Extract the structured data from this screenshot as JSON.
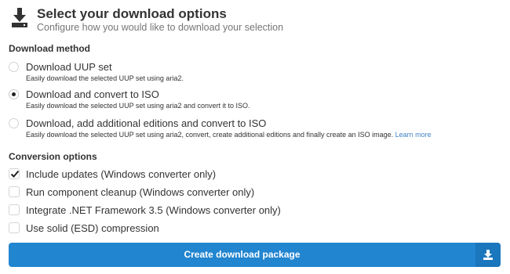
{
  "header": {
    "icon": "download-icon",
    "title": "Select your download options",
    "subtitle": "Configure how you would like to download your selection"
  },
  "download_method": {
    "title": "Download method",
    "options": [
      {
        "label": "Download UUP set",
        "description": "Easily download the selected UUP set using aria2.",
        "selected": false
      },
      {
        "label": "Download and convert to ISO",
        "description": "Easily download the selected UUP set using aria2 and convert it to ISO.",
        "selected": true
      },
      {
        "label": "Download, add additional editions and convert to ISO",
        "description": "Easily download the selected UUP set using aria2, convert, create additional editions and finally create an ISO image.",
        "link": "Learn more",
        "selected": false
      }
    ]
  },
  "conversion_options": {
    "title": "Conversion options",
    "options": [
      {
        "label": "Include updates (Windows converter only)",
        "checked": true
      },
      {
        "label": "Run component cleanup (Windows converter only)",
        "checked": false
      },
      {
        "label": "Integrate .NET Framework 3.5 (Windows converter only)",
        "checked": false
      },
      {
        "label": "Use solid (ESD) compression",
        "checked": false
      }
    ]
  },
  "create_button": {
    "label": "Create download package",
    "icon": "download-icon",
    "color": "#2185d0"
  }
}
